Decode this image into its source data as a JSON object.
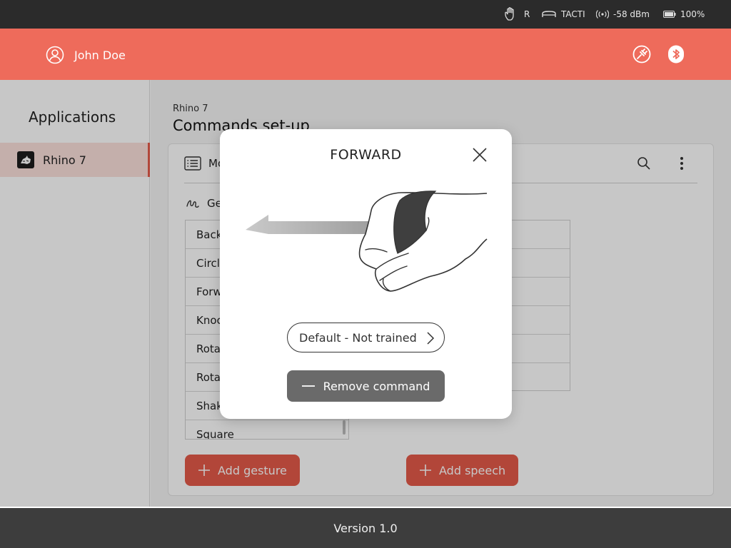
{
  "status": {
    "hand": "R",
    "device": "TACTI",
    "signal": "-58 dBm",
    "battery": "100%"
  },
  "header": {
    "user_name": "John Doe"
  },
  "sidebar": {
    "heading": "Applications",
    "items": [
      {
        "label": "Rhino 7"
      }
    ]
  },
  "main": {
    "breadcrumb": "Rhino 7",
    "title": "Commands set-up",
    "tab_label": "Mo",
    "section_label": "Ge",
    "gestures": [
      "Back",
      "Circl",
      "Forw",
      "Knoc",
      "Rota",
      "Rota",
      "Shak",
      "Square"
    ],
    "add_gesture_label": "Add gesture",
    "add_speech_label": "Add speech"
  },
  "footer": {
    "version": "Version 1.0"
  },
  "modal": {
    "title": "FORWARD",
    "trained_status": "Default - Not trained",
    "remove_label": "Remove command"
  },
  "colors": {
    "brand": "#ee6b5b",
    "accent": "#e45a4a",
    "statusbar": "#2b2b2b",
    "footer": "#3d3d3d"
  }
}
